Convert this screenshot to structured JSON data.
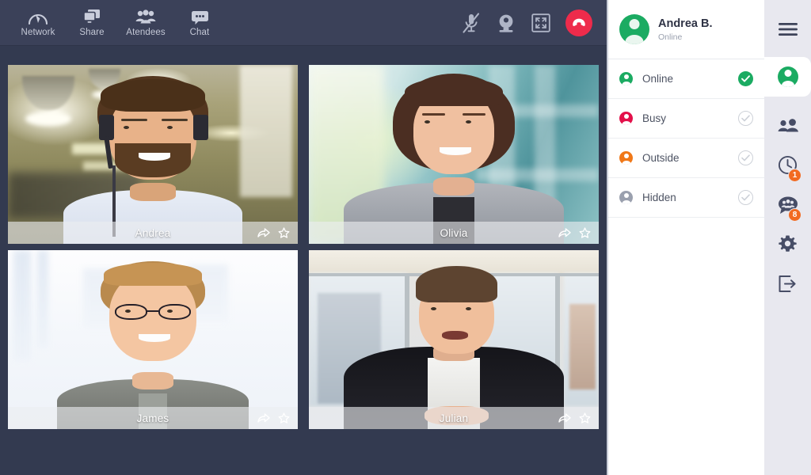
{
  "toolbar": {
    "buttons": [
      {
        "label": "Network",
        "icon": "network-gauge-icon"
      },
      {
        "label": "Share",
        "icon": "screen-share-icon"
      },
      {
        "label": "Atendees",
        "icon": "attendees-group-icon"
      },
      {
        "label": "Chat",
        "icon": "chat-bubble-icon"
      }
    ],
    "actions": [
      {
        "name": "microphone-muted-icon",
        "state": "muted"
      },
      {
        "name": "webcam-icon",
        "state": "on"
      },
      {
        "name": "fullscreen-icon",
        "state": "off"
      },
      {
        "name": "hangup-button",
        "state": "active"
      }
    ]
  },
  "grid": {
    "participants": [
      {
        "name": "Andrea",
        "scene": "office-warm",
        "share_icon": "share-arrow-icon",
        "star_icon": "star-icon"
      },
      {
        "name": "Olivia",
        "scene": "glass-teal",
        "share_icon": "share-arrow-icon",
        "star_icon": "star-icon"
      },
      {
        "name": "James",
        "scene": "studio-white",
        "share_icon": "share-arrow-icon",
        "star_icon": "star-icon"
      },
      {
        "name": "Julian",
        "scene": "office-city",
        "share_icon": "share-arrow-icon",
        "star_icon": "star-icon"
      }
    ]
  },
  "panel": {
    "user": {
      "name": "Andrea B.",
      "status": "Online",
      "avatar_icon": "user-avatar-icon"
    },
    "menu_icon": "hamburger-menu-icon",
    "statuses": [
      {
        "label": "Online",
        "color": "#1bab62",
        "selected": true
      },
      {
        "label": "Busy",
        "color": "#e3104a",
        "selected": false
      },
      {
        "label": "Outside",
        "color": "#f07818",
        "selected": false
      },
      {
        "label": "Hidden",
        "color": "#9aa0ae",
        "selected": false
      }
    ]
  },
  "rail": {
    "items": [
      {
        "name": "profile-icon",
        "badge": "",
        "active": true
      },
      {
        "name": "contacts-icon",
        "badge": "",
        "active": false
      },
      {
        "name": "history-clock-icon",
        "badge": "1",
        "active": false
      },
      {
        "name": "group-chat-icon",
        "badge": "8",
        "active": false
      },
      {
        "name": "settings-gear-icon",
        "badge": "",
        "active": false
      },
      {
        "name": "logout-icon",
        "badge": "",
        "active": false
      }
    ]
  },
  "colors": {
    "toolbar_bg": "#3b4159",
    "main_bg": "#333a50",
    "accent_green": "#1bab62",
    "accent_red": "#ee2b4b",
    "badge_orange": "#f26a21",
    "rail_bg": "#e8e8ef"
  }
}
